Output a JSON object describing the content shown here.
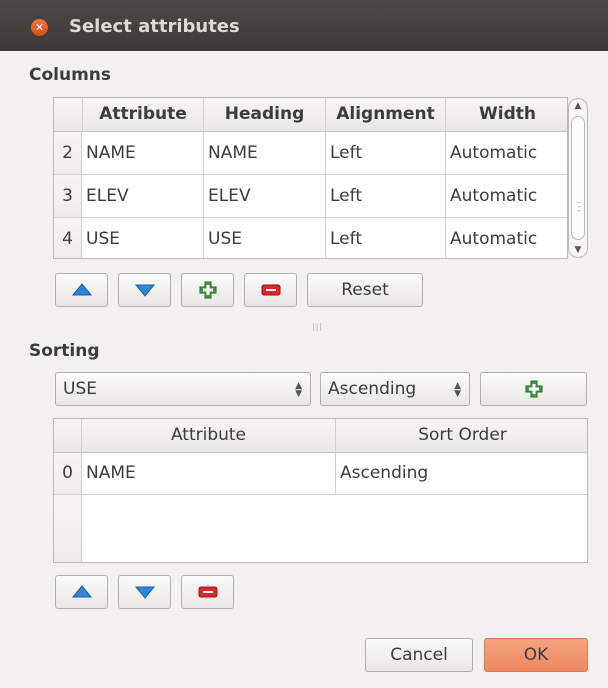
{
  "window": {
    "title": "Select attributes"
  },
  "columns": {
    "label": "Columns",
    "headers": [
      "Attribute",
      "Heading",
      "Alignment",
      "Width"
    ],
    "rows": [
      {
        "num": "2",
        "cells": [
          "NAME",
          "NAME",
          "Left",
          "Automatic"
        ]
      },
      {
        "num": "3",
        "cells": [
          "ELEV",
          "ELEV",
          "Left",
          "Automatic"
        ]
      },
      {
        "num": "4",
        "cells": [
          "USE",
          "USE",
          "Left",
          "Automatic"
        ]
      }
    ],
    "reset_label": "Reset"
  },
  "sorting": {
    "label": "Sorting",
    "attribute_select": "USE",
    "order_select": "Ascending",
    "headers": [
      "Attribute",
      "Sort Order"
    ],
    "rows": [
      {
        "num": "0",
        "cells": [
          "NAME",
          "Ascending"
        ]
      }
    ]
  },
  "footer": {
    "cancel_label": "Cancel",
    "ok_label": "OK"
  },
  "icons": {
    "up": "arrow-up-icon",
    "down": "arrow-down-icon",
    "add": "plus-icon",
    "remove": "minus-icon"
  },
  "colors": {
    "titlebar": "#3c3b37",
    "close": "#e05a23",
    "ok_button": "#f08e67",
    "arrow_icon": "#2f86d8",
    "add_icon": "#3ca23c",
    "remove_icon": "#d42a2a"
  }
}
